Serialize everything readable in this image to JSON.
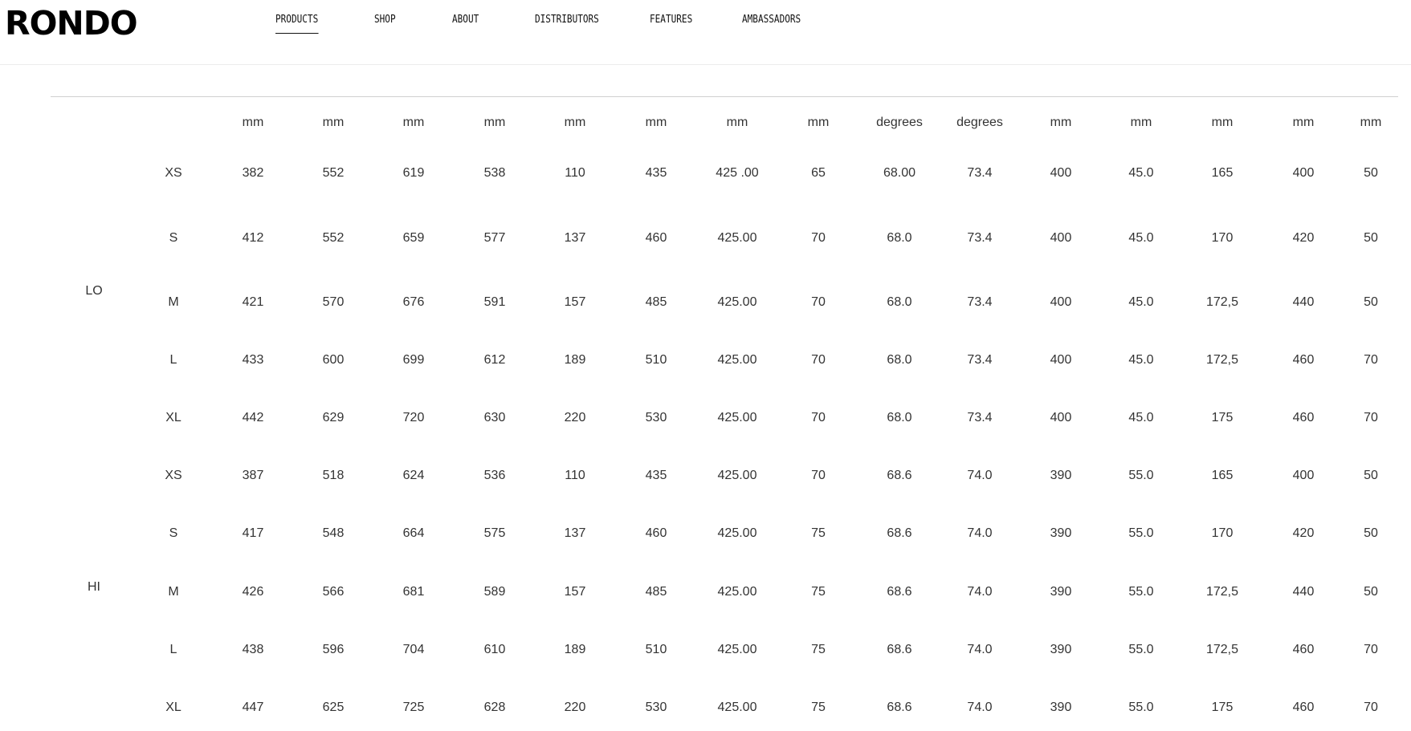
{
  "header": {
    "logo": "RONDO",
    "nav": [
      "PRODUCTS",
      "SHOP",
      "ABOUT",
      "DISTRIBUTORS",
      "FEATURES",
      "AMBASSADORS"
    ],
    "active_nav": "PRODUCTS"
  },
  "table": {
    "units": [
      "mm",
      "mm",
      "mm",
      "mm",
      "mm",
      "mm",
      "mm",
      "mm",
      "degrees",
      "degrees",
      "mm",
      "mm",
      "mm",
      "mm",
      "mm"
    ],
    "groups": [
      {
        "label": "LO",
        "rows": [
          {
            "size": "XS",
            "values": [
              "382",
              "552",
              "619",
              "538",
              "110",
              "435",
              "425 .00",
              "65",
              "68.00",
              "73.4",
              "400",
              "45.0",
              "165",
              "400",
              "50"
            ]
          },
          {
            "size": "S",
            "values": [
              "412",
              "552",
              "659",
              "577",
              "137",
              "460",
              "425.00",
              "70",
              "68.0",
              "73.4",
              "400",
              "45.0",
              "170",
              "420",
              "50"
            ]
          },
          {
            "size": "M",
            "values": [
              "421",
              "570",
              "676",
              "591",
              "157",
              "485",
              "425.00",
              "70",
              "68.0",
              "73.4",
              "400",
              "45.0",
              "172,5",
              "440",
              "50"
            ]
          },
          {
            "size": "L",
            "values": [
              "433",
              "600",
              "699",
              "612",
              "189",
              "510",
              "425.00",
              "70",
              "68.0",
              "73.4",
              "400",
              "45.0",
              "172,5",
              "460",
              "70"
            ]
          },
          {
            "size": "XL",
            "values": [
              "442",
              "629",
              "720",
              "630",
              "220",
              "530",
              "425.00",
              "70",
              "68.0",
              "73.4",
              "400",
              "45.0",
              "175",
              "460",
              "70"
            ]
          }
        ]
      },
      {
        "label": "HI",
        "rows": [
          {
            "size": "XS",
            "values": [
              "387",
              "518",
              "624",
              "536",
              "110",
              "435",
              "425.00",
              "70",
              "68.6",
              "74.0",
              "390",
              "55.0",
              "165",
              "400",
              "50"
            ]
          },
          {
            "size": "S",
            "values": [
              "417",
              "548",
              "664",
              "575",
              "137",
              "460",
              "425.00",
              "75",
              "68.6",
              "74.0",
              "390",
              "55.0",
              "170",
              "420",
              "50"
            ]
          },
          {
            "size": "M",
            "values": [
              "426",
              "566",
              "681",
              "589",
              "157",
              "485",
              "425.00",
              "75",
              "68.6",
              "74.0",
              "390",
              "55.0",
              "172,5",
              "440",
              "50"
            ]
          },
          {
            "size": "L",
            "values": [
              "438",
              "596",
              "704",
              "610",
              "189",
              "510",
              "425.00",
              "75",
              "68.6",
              "74.0",
              "390",
              "55.0",
              "172,5",
              "460",
              "70"
            ]
          },
          {
            "size": "XL",
            "values": [
              "447",
              "625",
              "725",
              "628",
              "220",
              "530",
              "425.00",
              "75",
              "68.6",
              "74.0",
              "390",
              "55.0",
              "175",
              "460",
              "70"
            ]
          }
        ]
      }
    ]
  }
}
